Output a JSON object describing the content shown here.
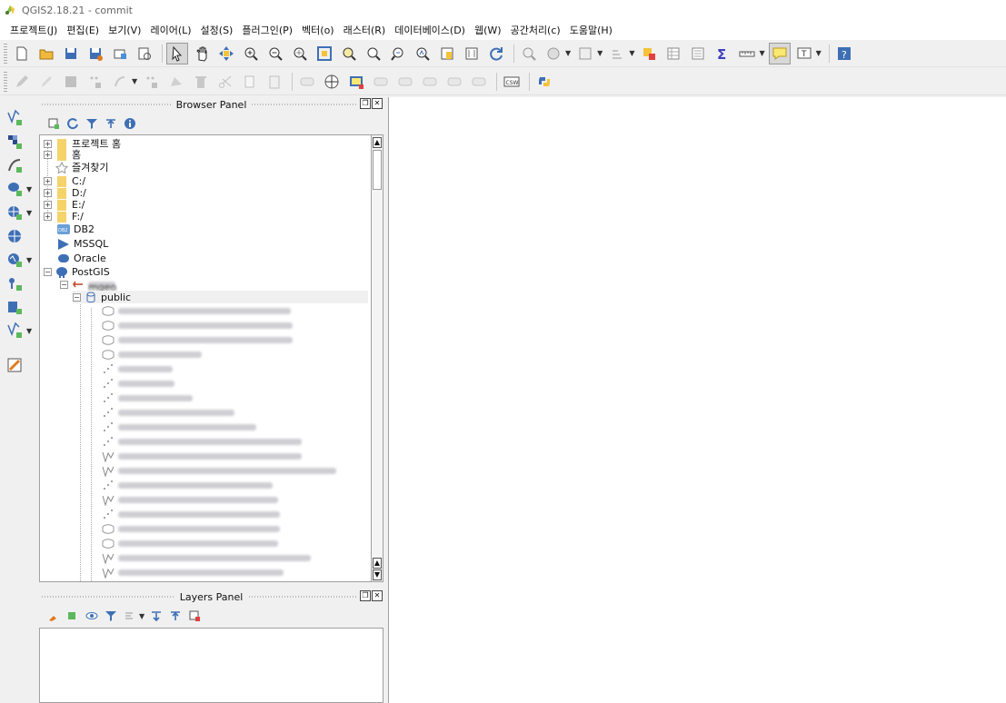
{
  "window": {
    "title": "QGIS2.18.21 - commit"
  },
  "menu": [
    "프로젝트(J)",
    "편집(E)",
    "보기(V)",
    "레이어(L)",
    "설정(S)",
    "플러그인(P)",
    "벡터(o)",
    "래스터(R)",
    "데이터베이스(D)",
    "웹(W)",
    "공간처리(c)",
    "도움말(H)"
  ],
  "toolbar1": [
    "new-project-icon",
    "open-project-icon",
    "save-project-icon",
    "save-as-icon",
    "print-composer-icon",
    "composer-manager-icon",
    "select-icon",
    "pan-icon",
    "pan-to-selection-icon",
    "zoom-in-icon",
    "zoom-out-icon",
    "zoom-full-icon",
    "zoom-to-selection-icon",
    "zoom-to-layer-icon",
    "zoom-last-icon",
    "zoom-next-icon",
    "new-bookmark-icon",
    "show-bookmarks-icon",
    "refresh-icon",
    "identify-icon",
    "measure-icon",
    "select-features-icon",
    "deselect-icon",
    "statistics-icon",
    "open-attribute-table-icon",
    "field-calculator-icon",
    "sum-icon",
    "measure-line-icon",
    "map-tips-icon",
    "text-annotation-icon",
    "help-icon"
  ],
  "toolbar2": [
    "current-edits-icon",
    "toggle-editing-icon",
    "save-edits-icon",
    "add-feature-icon",
    "move-feature-icon",
    "node-tool-icon",
    "delete-selected-icon",
    "cut-features-icon",
    "copy-features-icon",
    "paste-features-icon",
    "label-icon",
    "pin-labels-icon",
    "highlight-labels-icon",
    "move-label-icon",
    "rotate-label-icon",
    "change-label-icon",
    "show-hide-labels-icon",
    "csw-icon",
    "python-console-icon"
  ],
  "browser_panel": {
    "title": "Browser Panel",
    "nodes": [
      {
        "label": "프로젝트 홈"
      },
      {
        "label": "홈"
      },
      {
        "label": "즐겨찾기"
      },
      {
        "label": "C:/"
      },
      {
        "label": "D:/"
      },
      {
        "label": "E:/"
      },
      {
        "label": "F:/"
      },
      {
        "label": "DB2"
      },
      {
        "label": "MSSQL"
      },
      {
        "label": "Oracle"
      },
      {
        "label": "PostGIS"
      },
      {
        "label": "mgeo"
      },
      {
        "label": "public"
      }
    ]
  },
  "layers_panel": {
    "title": "Layers Panel"
  },
  "colors": {
    "accent": "#316ac5",
    "folder": "#f5d36b",
    "background": "#f0f0f0",
    "panel": "#ffffff"
  }
}
